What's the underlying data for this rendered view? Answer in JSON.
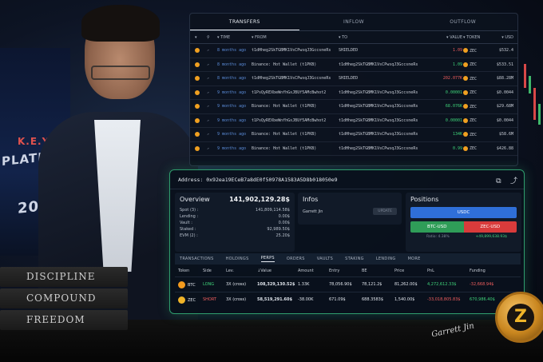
{
  "backdrop": {
    "stage_key": "K.E.Y.",
    "stage_platform": "PLATFORM",
    "stage_year": "2019",
    "books": [
      "DISCIPLINE",
      "COMPOUND",
      "FREEDOM"
    ],
    "signature": "Garrett Jin",
    "medal_symbol": "Z"
  },
  "transfers_panel": {
    "tabs": [
      {
        "label": "TRANSFERS",
        "active": true
      },
      {
        "label": "INFLOW",
        "active": false
      },
      {
        "label": "OUTFLOW",
        "active": false
      }
    ],
    "columns": {
      "time": "TIME",
      "from": "FROM",
      "to": "TO",
      "value": "VALUE",
      "token": "TOKEN",
      "usd": "USD"
    },
    "rows": [
      {
        "time": "8 months ago",
        "from": "t1dHheg2SkTGBMK1VsCPwsqJ3GccsneRs",
        "to": "SHIELDED",
        "value": "1.09",
        "value_color": "red",
        "token": "ZEC",
        "usd": "$532.4"
      },
      {
        "time": "8 months ago",
        "from": "Binance: Hot Wallet (t1PKB)",
        "to": "t1dHheg2SkTGBMK1VsCPwsqJ3GccsneRs",
        "value": "1.09",
        "value_color": "green",
        "token": "ZEC",
        "usd": "$533.51"
      },
      {
        "time": "8 months ago",
        "from": "t1dHheg2SkTGBMK1VsCPwsqJ3GccsneRs",
        "to": "SHIELDED",
        "value": "202.077K",
        "value_color": "red",
        "token": "ZEC",
        "usd": "$88.28M"
      },
      {
        "time": "9 months ago",
        "from": "t1PsQyREXbeWnfhGxJBUf5AMcBwhot2",
        "to": "t1dHheg2SkTGBMK1VsCPwsqJ3GccsneRs",
        "value": "0.00001",
        "value_color": "green",
        "token": "ZEC",
        "usd": "$0.0044"
      },
      {
        "time": "9 months ago",
        "from": "Binance: Hot Wallet (t1PKB)",
        "to": "t1dHheg2SkTGBMK1VsCPwsqJ3GccsneRs",
        "value": "68.076K",
        "value_color": "green",
        "token": "ZEC",
        "usd": "$29.68M"
      },
      {
        "time": "9 months ago",
        "from": "t1PsQyREXbeWnfhGxJBUf5AMcBwhot2",
        "to": "t1dHheg2SkTGBMK1VsCPwsqJ3GccsneRs",
        "value": "0.00001",
        "value_color": "green",
        "token": "ZEC",
        "usd": "$0.0044"
      },
      {
        "time": "9 months ago",
        "from": "Binance: Hot Wallet (t1PKB)",
        "to": "t1dHheg2SkTGBMK1VsCPwsqJ3GccsneRs",
        "value": "134K",
        "value_color": "green",
        "token": "ZEC",
        "usd": "$58.6M"
      },
      {
        "time": "9 months ago",
        "from": "Binance: Hot Wallet (t1PKB)",
        "to": "t1dHheg2SkTGBMK1VsCPwsqJ3GccsneRs",
        "value": "0.99",
        "value_color": "green",
        "token": "ZEC",
        "usd": "$426.88"
      }
    ]
  },
  "account_panel": {
    "address_label": "Address:",
    "address": "0x92ea19ECeB7a8dE0f50978A1583A5D8b018050e9",
    "overview": {
      "title": "Overview",
      "total": "141,902,129.28$",
      "lines": [
        {
          "label": "Spot (3) :",
          "value": "141,809,114.58$"
        },
        {
          "label": "Lending :",
          "value": "0.00$"
        },
        {
          "label": "Vault :",
          "value": "0.00$"
        },
        {
          "label": "Staked :",
          "value": "92,989.50$"
        },
        {
          "label": "EVM (2) :",
          "value": "25.20$"
        }
      ]
    },
    "infos": {
      "title": "Infos",
      "name": "Garrett Jin",
      "update_label": "UPDATE"
    },
    "positions": {
      "title": "Positions",
      "usdc_label": "USDC",
      "btc_label": "BTC-USD",
      "zec_label": "ZEC-USD",
      "foot_left": "Ratio: 4.38%",
      "foot_right": "+49,899,638.93$"
    },
    "subtabs": [
      {
        "label": "TRANSACTIONS",
        "active": false
      },
      {
        "label": "HOLDINGS",
        "active": false
      },
      {
        "label": "PERPS",
        "active": true
      },
      {
        "label": "ORDERS",
        "active": false
      },
      {
        "label": "VAULTS",
        "active": false
      },
      {
        "label": "STAKING",
        "active": false
      },
      {
        "label": "LENDING",
        "active": false
      },
      {
        "label": "MORE",
        "active": false
      }
    ],
    "perps_columns": [
      "Token",
      "Side",
      "Lev.",
      "Value",
      "Amount",
      "Entry",
      "BE",
      "Price",
      "PnL",
      "Funding"
    ],
    "perps_rows": [
      {
        "token": "BTC",
        "side": "LONG",
        "lev": "3X (cross)",
        "value": "108,329,130.52$",
        "amount": "1.33K",
        "entry": "78,056.90$",
        "be": "78,121.2$",
        "price": "81,262.00$",
        "pnl": "4,272,612.33$",
        "pnl_color": "green",
        "funding": "-32,668.94$",
        "funding_color": "red"
      },
      {
        "token": "ZEC",
        "side": "SHORT",
        "lev": "3X (cross)",
        "value": "58,519,291.60$",
        "amount": "-38.00K",
        "entry": "671.09$",
        "be": "688.3583$",
        "price": "1,540.00$",
        "pnl": "-33,018,805.83$",
        "pnl_color": "red",
        "funding": "670,986.40$",
        "funding_color": "green"
      }
    ]
  },
  "colors": {
    "green": "#3fd37a",
    "red": "#f05e5e",
    "usdc_blue": "#2f6fd8",
    "panel_border": "#2f9d6d",
    "zec_gold": "#f0b429"
  }
}
